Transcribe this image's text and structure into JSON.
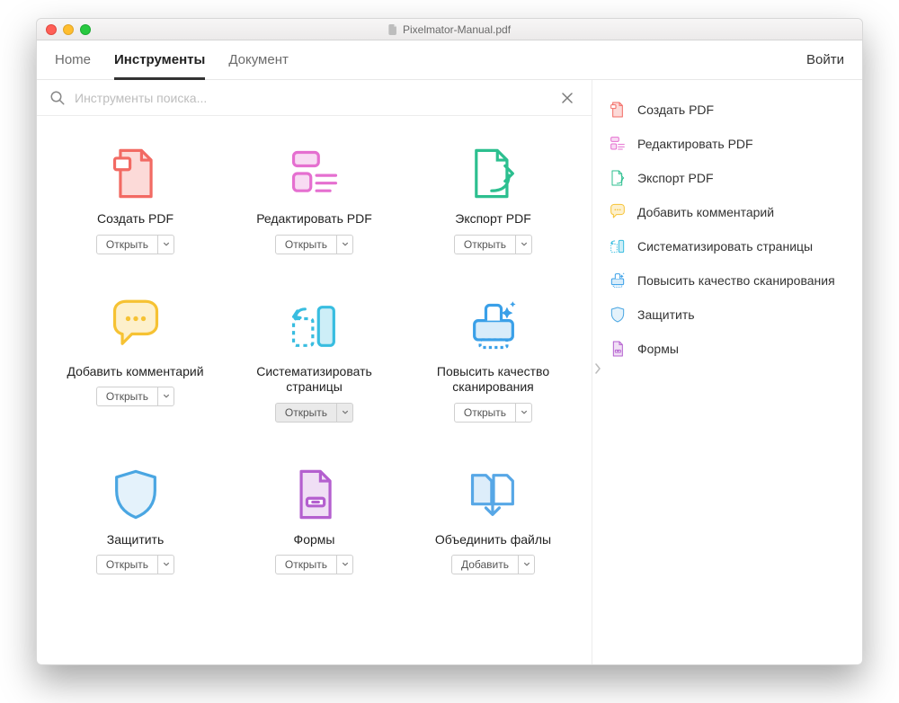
{
  "window": {
    "title": "Pixelmator-Manual.pdf"
  },
  "tabs": {
    "home": "Home",
    "tools": "Инструменты",
    "document": "Документ",
    "login": "Войти"
  },
  "search": {
    "placeholder": "Инструменты поиска..."
  },
  "buttons": {
    "open": "Открыть",
    "add": "Добавить"
  },
  "tools": [
    {
      "id": "create-pdf",
      "label": "Создать PDF",
      "button": "open",
      "icon": "create",
      "color": "#f26a63"
    },
    {
      "id": "edit-pdf",
      "label": "Редактировать PDF",
      "button": "open",
      "icon": "edit",
      "color": "#e56fd0"
    },
    {
      "id": "export-pdf",
      "label": "Экспорт PDF",
      "button": "open",
      "icon": "export",
      "color": "#2cbf8f"
    },
    {
      "id": "add-comment",
      "label": "Добавить комментарий",
      "button": "open",
      "icon": "comment",
      "color": "#f6c233"
    },
    {
      "id": "organize",
      "label": "Систематизировать страницы",
      "button": "open",
      "icon": "organize",
      "color": "#38bde0",
      "pressed": true
    },
    {
      "id": "enhance",
      "label": "Повысить качество сканирования",
      "button": "open",
      "icon": "enhance",
      "color": "#3aa0e8"
    },
    {
      "id": "protect",
      "label": "Защитить",
      "button": "open",
      "icon": "protect",
      "color": "#4aa6e2"
    },
    {
      "id": "forms",
      "label": "Формы",
      "button": "open",
      "icon": "forms",
      "color": "#b45fcf"
    },
    {
      "id": "combine",
      "label": "Объединить файлы",
      "button": "add",
      "icon": "combine",
      "color": "#57a7e6"
    }
  ],
  "sidebar": [
    {
      "id": "create-pdf",
      "label": "Создать PDF",
      "icon": "create",
      "color": "#f26a63"
    },
    {
      "id": "edit-pdf",
      "label": "Редактировать PDF",
      "icon": "edit",
      "color": "#e56fd0"
    },
    {
      "id": "export-pdf",
      "label": "Экспорт PDF",
      "icon": "export",
      "color": "#2cbf8f"
    },
    {
      "id": "add-comment",
      "label": "Добавить комментарий",
      "icon": "comment",
      "color": "#f6c233"
    },
    {
      "id": "organize",
      "label": "Систематизировать страницы",
      "icon": "organize",
      "color": "#38bde0"
    },
    {
      "id": "enhance",
      "label": "Повысить качество сканирования",
      "icon": "enhance",
      "color": "#3aa0e8"
    },
    {
      "id": "protect",
      "label": "Защитить",
      "icon": "protect",
      "color": "#4aa6e2"
    },
    {
      "id": "forms",
      "label": "Формы",
      "icon": "forms",
      "color": "#b45fcf"
    }
  ]
}
